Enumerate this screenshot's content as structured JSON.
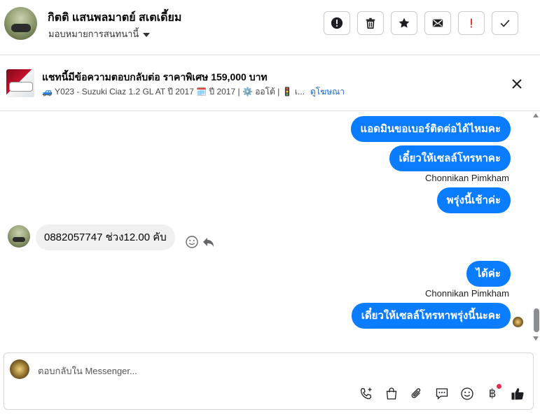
{
  "header": {
    "name": "กิตติ แสนพลมาตย์ สเตเดี้ยม",
    "subtitle": "มอบหมายการสนทนานี้"
  },
  "banner": {
    "title": "แชทนี้มีข้อความตอบกลับต่อ ราคาพิเศษ 159,000 บาท",
    "details": "🚙 Y023 - Suzuki Ciaz 1.2 GL AT ปี 2017 🗓️ ปี 2017 | ⚙️ ออโต้ | 🚦 เ...",
    "link": "ดูโฆษณา"
  },
  "messages": {
    "out1": "แอดมินขอเบอร์ติดต่อได้ไหมคะ",
    "out2": "เดี๋ยวให้เซลล์โทรหาคะ",
    "sender1": "Chonnikan Pimkham",
    "out3": "พรุ่งนี้เช้าค่ะ",
    "in1": "0882057747 ช่วง12.00 คับ",
    "out4": "ได้ค่ะ",
    "sender2": "Chonnikan Pimkham",
    "out5": "เดี๋ยวให้เซลล์โทรหาพรุ่งนี้นะคะ"
  },
  "composer": {
    "placeholder": "ตอบกลับใน Messenger...",
    "currency_symbol": "฿"
  },
  "icons": {
    "header_actions": [
      "report-icon",
      "trash-icon",
      "star-icon",
      "mail-icon",
      "exclamation-icon",
      "check-icon"
    ],
    "toolbar": [
      "phone-add-icon",
      "shopping-bag-icon",
      "paperclip-icon",
      "message-icon",
      "emoji-icon",
      "baht-icon",
      "thumbs-up-icon"
    ]
  },
  "colors": {
    "outgoing_bubble": "#0a7cff",
    "incoming_bubble": "#f0f0f0",
    "link": "#1a66c7",
    "alert_red": "#e02020"
  }
}
